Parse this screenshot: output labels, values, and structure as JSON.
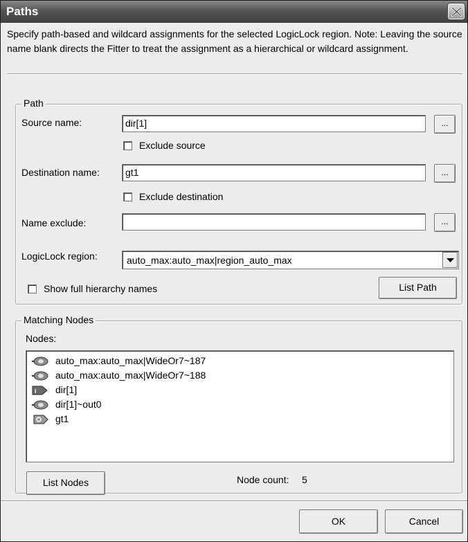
{
  "window": {
    "title": "Paths",
    "description": "Specify path-based and wildcard assignments for the selected LogicLock region. Note: Leaving the source name blank directs the Fitter to treat the assignment as a hierarchical or wildcard assignment."
  },
  "path_group": {
    "legend": "Path",
    "source_label": "Source name:",
    "source_value": "dir[1]",
    "exclude_source_label": "Exclude source",
    "exclude_source_checked": false,
    "destination_label": "Destination name:",
    "destination_value": "gt1",
    "exclude_destination_label": "Exclude destination",
    "exclude_destination_checked": false,
    "name_exclude_label": "Name exclude:",
    "name_exclude_value": "",
    "browse_label": "...",
    "region_label": "LogicLock region:",
    "region_value": "auto_max:auto_max|region_auto_max",
    "show_hierarchy_label": "Show full hierarchy names",
    "show_hierarchy_checked": false,
    "list_path_label": "List Path"
  },
  "matching_group": {
    "legend": "Matching Nodes",
    "nodes_label": "Nodes:",
    "nodes": [
      {
        "name": "auto_max:auto_max|WideOr7~187",
        "icon": "combinational-node-icon"
      },
      {
        "name": "auto_max:auto_max|WideOr7~188",
        "icon": "combinational-node-icon"
      },
      {
        "name": "dir[1]",
        "icon": "input-pin-icon"
      },
      {
        "name": "dir[1]~out0",
        "icon": "combinational-node-icon"
      },
      {
        "name": "gt1",
        "icon": "output-pin-icon"
      }
    ],
    "list_nodes_label": "List Nodes",
    "node_count_label": "Node count:",
    "node_count_value": "5"
  },
  "footer": {
    "ok_label": "OK",
    "cancel_label": "Cancel"
  }
}
